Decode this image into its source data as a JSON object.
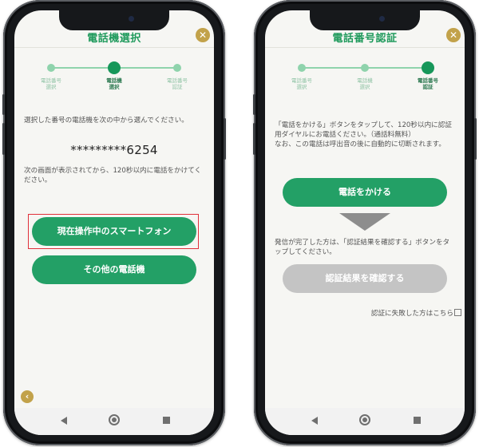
{
  "left_screen": {
    "title": "電話機選択",
    "close_glyph": "✕",
    "steps": [
      {
        "label": "電話番号\n選択",
        "active": false
      },
      {
        "label": "電話機\n選択",
        "active": true
      },
      {
        "label": "電話番号\n認証",
        "active": false
      }
    ],
    "instruction": "選択した番号の電話機を次の中から選んでください。",
    "phone_number": "*********6254",
    "note": "次の画面が表示されてから、120秒以内に電話をかけてください。",
    "buttons": {
      "current_smartphone": "現在操作中のスマートフォン",
      "other_phone": "その他の電話機"
    },
    "highlighted_button": "current_smartphone",
    "back_glyph": "‹"
  },
  "right_screen": {
    "title": "電話番号認証",
    "close_glyph": "✕",
    "steps": [
      {
        "label": "電話番号\n選択",
        "active": false
      },
      {
        "label": "電話機\n選択",
        "active": false
      },
      {
        "label": "電話番号\n認証",
        "active": true
      }
    ],
    "instruction": "「電話をかける」ボタンをタップして、120秒以内に認証用ダイヤルにお電話ください。（通話料無料）\nなお、この電話は呼出音の後に自動的に切断されます。",
    "buttons": {
      "call": "電話をかける",
      "confirm_result": "認証結果を確認する"
    },
    "confirm_enabled": false,
    "after_call_text": "発信が完了した方は、「認証結果を確認する」ボタンをタップしてください。",
    "fail_link": "認証に失敗した方はこちら"
  },
  "icons": {
    "close": "close-icon",
    "back": "chevron-left-icon",
    "arrow": "arrow-down-icon",
    "external": "external-link-icon",
    "nav_back": "nav-back-icon",
    "nav_home": "nav-home-icon",
    "nav_recent": "nav-recent-apps-icon"
  },
  "colors": {
    "accent": "#23a066",
    "title": "#1f9a5c",
    "step_inactive": "#8fd3ac",
    "close_button": "#c2a24a",
    "highlight": "#e0303a",
    "disabled_button": "#c4c4c4"
  }
}
